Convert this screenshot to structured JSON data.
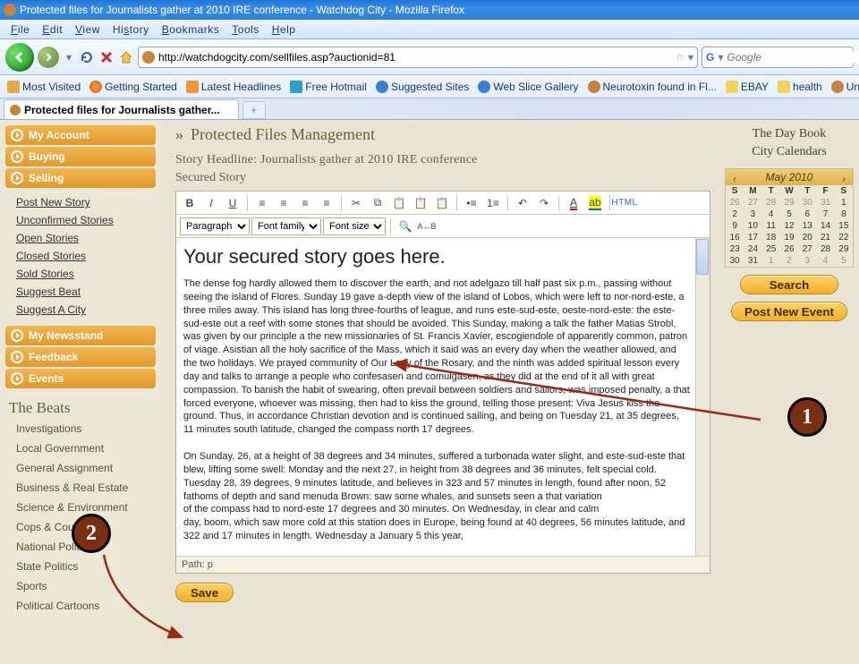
{
  "window": {
    "title": "Protected files for Journalists gather at 2010 IRE conference - Watchdog City - Mozilla Firefox"
  },
  "menu": {
    "file": "File",
    "edit": "Edit",
    "view": "View",
    "history": "History",
    "bookmarks": "Bookmarks",
    "tools": "Tools",
    "help": "Help"
  },
  "nav": {
    "url": "http://watchdogcity.com/sellfiles.asp?auctionid=81",
    "search_placeholder": "Google"
  },
  "bookmarks": [
    "Most Visited",
    "Getting Started",
    "Latest Headlines",
    "Free Hotmail",
    "Suggested Sites",
    "Web Slice Gallery",
    "Neurotoxin found in Fl...",
    "EBAY",
    "health",
    "Universal Terms of"
  ],
  "tab": {
    "label": "Protected files for Journalists gather..."
  },
  "sidebar": {
    "sections": [
      {
        "label": "My Account"
      },
      {
        "label": "Buying"
      },
      {
        "label": "Selling"
      }
    ],
    "selling_links": [
      "Post New Story",
      "Unconfirmed Stories",
      "Open Stories",
      "Closed Stories",
      "Sold Stories",
      "Suggest Beat",
      "Suggest A City"
    ],
    "sections2": [
      {
        "label": "My Newsstand"
      },
      {
        "label": "Feedback"
      },
      {
        "label": "Events"
      }
    ],
    "beats_heading": "The Beats",
    "beats": [
      "Investigations",
      "Local Government",
      "General Assignment",
      "Business & Real Estate",
      "Science & Environment",
      "Cops & Courts",
      "National Politics",
      "State Politics",
      "Sports",
      "Political Cartoons"
    ]
  },
  "main": {
    "breadcrumb_sep": "»",
    "page_title": "Protected Files Management",
    "headline_label": "Story Headline: Journalists gather at 2010 IRE conference",
    "subheading": "Secured Story",
    "toolbar_selects": {
      "paragraph": "Paragraph",
      "font_family": "Font family",
      "font_size": "Font size"
    },
    "html_btn": "HTML",
    "doc_heading": "Your secured story goes here.",
    "doc_body": "The dense fog hardly allowed them to discover the earth, and not adelgazo till half past six p.m., passing without seeing the island of Flores. Sunday 19 gave a-depth view of the island of Lobos, which were left to nor-nord-este, a three miles away. This island has long three-fourths of league, and runs este-sud-este, oeste-nord-este: the este-sud-este out a reef with some stones that should be avoided. This Sunday, making a talk the father Matias Strobl, was given by our principle a the new missionaries of St. Francis Xavier, escogiendole of apparently common, patron of viage. Asistian all the holy sacrifice of the Mass, which it said was an every day when the weather allowed, and the two holidays. We prayed community of Our Lady of the Rosary, and the ninth was added spiritual lesson every day and talks to arrange a people who confesasen and comulgasen, as they did at the end of it all with great compassion. To banish the habit of swearing, often prevail between soldiers and sailors, was imposed penalty, a that forced everyone, whoever was missing, then had to kiss the ground, telling those present: Viva Jesus kiss the ground. Thus, in accordance Christian devotion and is continued sailing, and being on Tuesday 21, at 35 degrees, 11 minutes south latitude, changed the compass north 17 degrees.\n\nOn Sunday, 26, at a height of 38 degrees and 34 minutes, suffered a turbonada water slight, and este-sud-este that blew, lifting some swell: Monday and the next 27, in height from 38 degrees and 36 minutes, felt special cold. Tuesday 28, 39 degrees, 9 minutes latitude, and believes in 323 and 57 minutes in length, found after noon, 52 fathoms of depth and sand menuda Brown: saw some whales, and sunsets seen a that variation\nof the compass had to nord-este 17 degrees and 30 minutes. On Wednesday, in clear and calm\nday, boom, which saw more cold at this station does in Europe, being found at 40 degrees, 56 minutes latitude, and 322 and 17 minutes in length. Wednesday a January 5 this year,",
    "path_label": "Path: p",
    "save": "Save"
  },
  "right": {
    "link1": "The Day Book",
    "link2": "City Calendars",
    "cal_title": "May 2010",
    "dow": [
      "S",
      "M",
      "T",
      "W",
      "T",
      "F",
      "S"
    ],
    "weeks": [
      [
        "26",
        "27",
        "28",
        "29",
        "30",
        "31",
        "1"
      ],
      [
        "2",
        "3",
        "4",
        "5",
        "6",
        "7",
        "8"
      ],
      [
        "9",
        "10",
        "11",
        "12",
        "13",
        "14",
        "15"
      ],
      [
        "16",
        "17",
        "18",
        "19",
        "20",
        "21",
        "22"
      ],
      [
        "23",
        "24",
        "25",
        "26",
        "27",
        "28",
        "29"
      ],
      [
        "30",
        "31",
        "1",
        "2",
        "3",
        "4",
        "5"
      ]
    ],
    "search_btn": "Search",
    "post_btn": "Post New Event"
  },
  "annotations": {
    "a1": "1",
    "a2": "2"
  }
}
